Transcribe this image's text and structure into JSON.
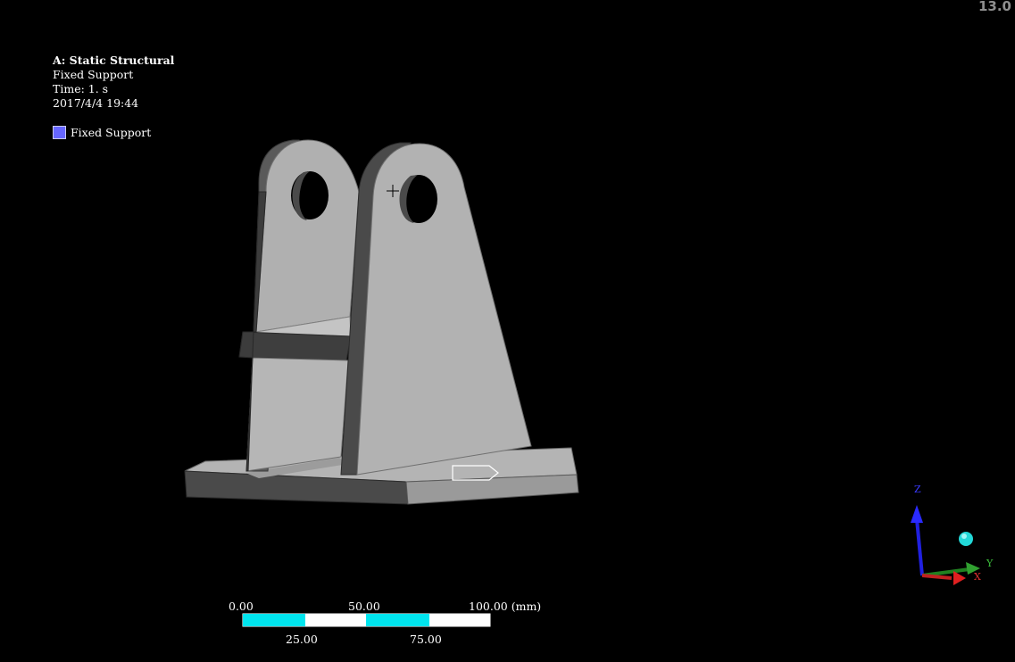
{
  "app": {
    "version": "13.0"
  },
  "annotation": {
    "title": "A: Static Structural",
    "item": "Fixed Support",
    "time": "Time: 1. s",
    "date": "2017/4/4 19:44"
  },
  "legend": {
    "label": "Fixed Support",
    "color": "#6666ff"
  },
  "scale_bar": {
    "top_labels": [
      "0.00",
      "50.00",
      "100.00 (mm)"
    ],
    "bottom_labels": [
      "25.00",
      "75.00"
    ],
    "fill_color": "#00e5ee"
  },
  "triad": {
    "z": "Z",
    "y": "Y",
    "x": "X"
  }
}
